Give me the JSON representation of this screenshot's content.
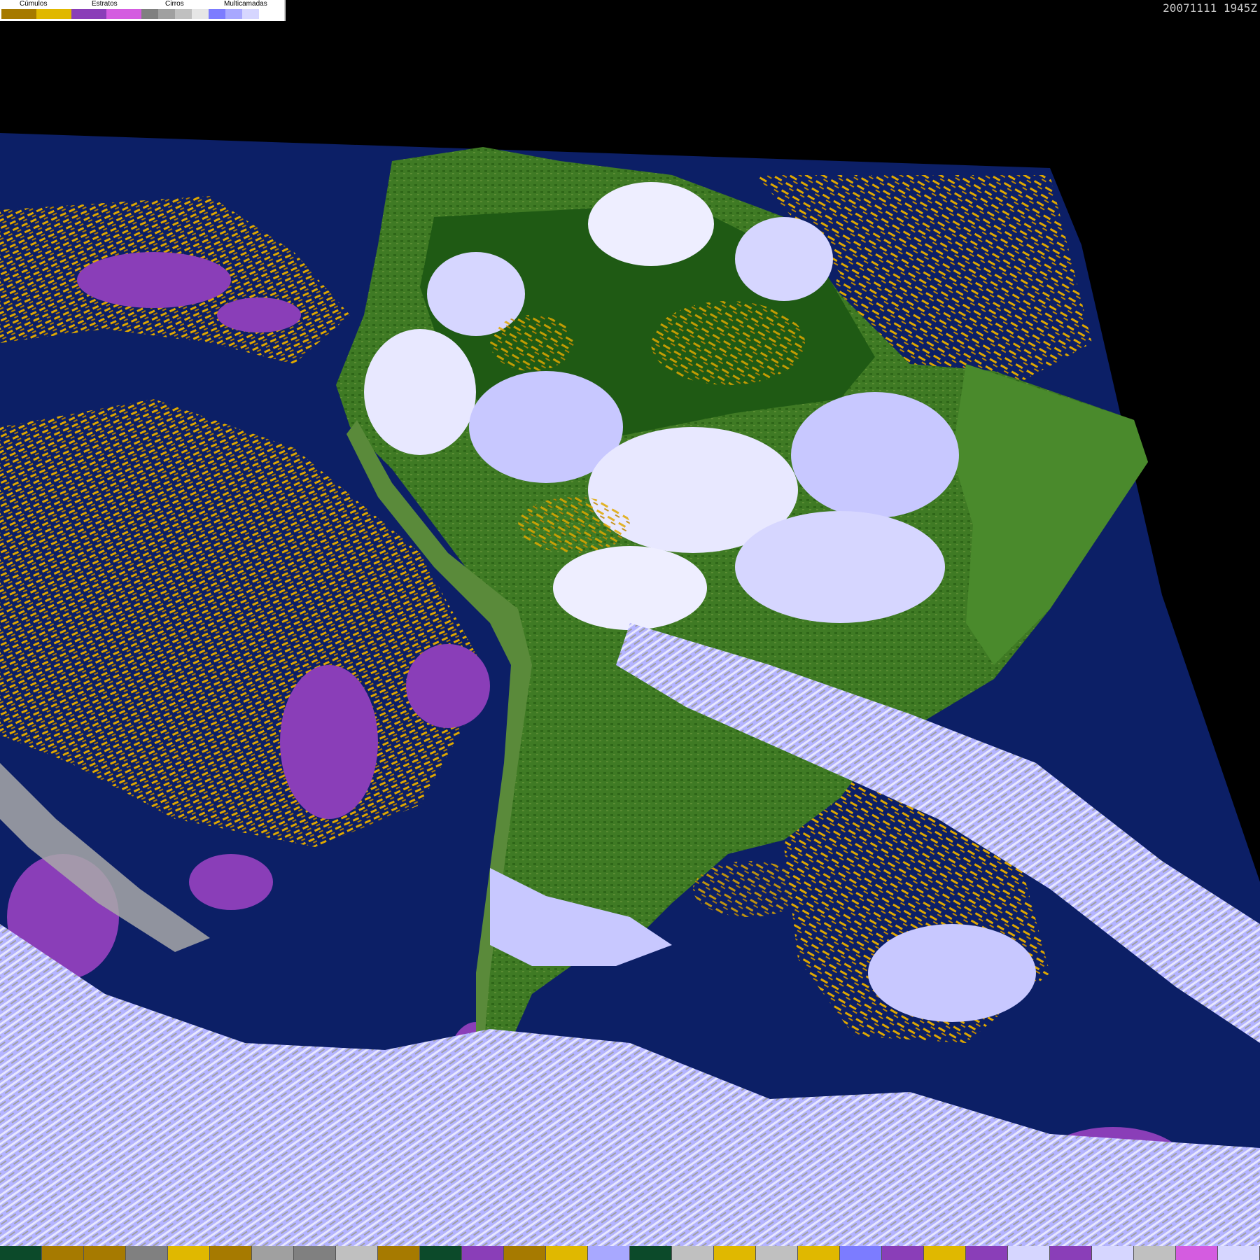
{
  "legend": {
    "groups": [
      {
        "label": "Cúmulos",
        "colors": [
          "#a67a00",
          "#e0b800"
        ]
      },
      {
        "label": "Estratos",
        "colors": [
          "#8a3eb8",
          "#d45ce0"
        ]
      },
      {
        "label": "Cirros",
        "colors": [
          "#808080",
          "#a0a0a0",
          "#c0c0c0",
          "#e6e6e6"
        ]
      },
      {
        "label": "Multicamadas",
        "colors": [
          "#7c7cff",
          "#a8a8ff",
          "#d6d6ff"
        ]
      }
    ]
  },
  "timestamp": "20071111 1945Z",
  "colors": {
    "ocean": "#0c1f66",
    "land": "#3a6e1e",
    "land_dark": "#1f5a14",
    "cumulus": "#e0a800",
    "stratus": "#8a3eb8",
    "cirrus_gray": "#a8a8a8",
    "multi": "#c8c8ff",
    "white_cloud": "#f0f0ff"
  },
  "bottom_bar": [
    "#0c4a2a",
    "#a67a00",
    "#a67a00",
    "#808080",
    "#e0b800",
    "#a67a00",
    "#a0a0a0",
    "#808080",
    "#c0c0c0",
    "#a67a00",
    "#0c4a2a",
    "#8a3eb8",
    "#a67a00",
    "#e0b800",
    "#a8a8ff",
    "#0c4a2a",
    "#c0c0c0",
    "#e0b800",
    "#c0c0c0",
    "#e0b800",
    "#7c7cff",
    "#8a3eb8",
    "#e0b800",
    "#8a3eb8",
    "#d6d6ff",
    "#8a3eb8",
    "#d6d6ff",
    "#c0c0c0",
    "#d45ce0",
    "#d6d6ff"
  ]
}
